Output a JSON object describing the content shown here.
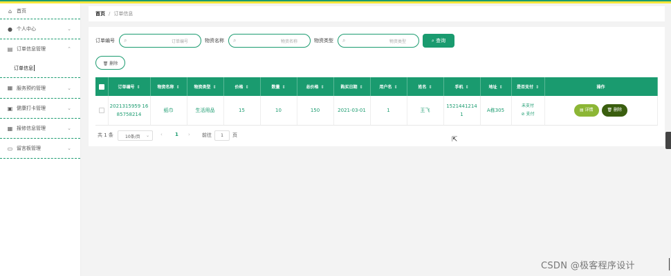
{
  "sidebar": {
    "items": [
      {
        "icon": "home-icon",
        "glyph": "⌂",
        "label": "首页",
        "chevron": ""
      },
      {
        "icon": "user-icon",
        "glyph": "●",
        "label": "个人中心",
        "chevron": "⌄"
      },
      {
        "icon": "order-icon",
        "glyph": "▤",
        "label": "订单信息管理",
        "chevron": "⌃"
      },
      {
        "icon": "service-icon",
        "glyph": "▦",
        "label": "服务预约管理",
        "chevron": "⌄"
      },
      {
        "icon": "grid-icon",
        "glyph": "▣",
        "label": "健康打卡管理",
        "chevron": "⌄"
      },
      {
        "icon": "repair-icon",
        "glyph": "▦",
        "label": "报修信息管理",
        "chevron": "⌄"
      },
      {
        "icon": "message-icon",
        "glyph": "▭",
        "label": "留言板管理",
        "chevron": "⌄"
      }
    ],
    "subitem": "订单信息"
  },
  "breadcrumb": {
    "home": "首页",
    "sep": "/",
    "current": "订单信息"
  },
  "filters": [
    {
      "label": "订单编号",
      "placeholder": "订单编号"
    },
    {
      "label": "物资名称",
      "placeholder": "物资名称"
    },
    {
      "label": "物资类型",
      "placeholder": "物资类型"
    }
  ],
  "search_button": "⌕ 查询",
  "delete_button": "🗑 删除",
  "table": {
    "columns": [
      "订单编号",
      "物资名称",
      "物资类型",
      "价格",
      "数量",
      "总价格",
      "购买日期",
      "用户名",
      "姓名",
      "手机",
      "地址",
      "是否支付",
      "操作"
    ],
    "rows": [
      {
        "order_no": "2021315959 1685758214",
        "name": "纸巾",
        "type": "生活用品",
        "price": "15",
        "qty": "10",
        "total": "150",
        "date": "2021-03-01",
        "username": "1",
        "realname": "王飞",
        "phone": "1521441214 1",
        "address": "A栋305",
        "paid": "未支付",
        "pay_link": "⊘ 支付",
        "detail": "▤ 详情",
        "delete": "🗑 删除"
      }
    ]
  },
  "pagination": {
    "total": "共 1 条",
    "size": "10条/页",
    "prev": "‹",
    "page": "1",
    "next": "›",
    "goto": "前往",
    "goto_value": "1",
    "page_unit": "页"
  },
  "watermark": "CSDN @极客程序设计",
  "colors": {
    "primary": "#1a9b6f",
    "accent_yellow": "#f5e63a",
    "detail_btn": "#8cb635",
    "delete_btn": "#3a5e0f"
  }
}
